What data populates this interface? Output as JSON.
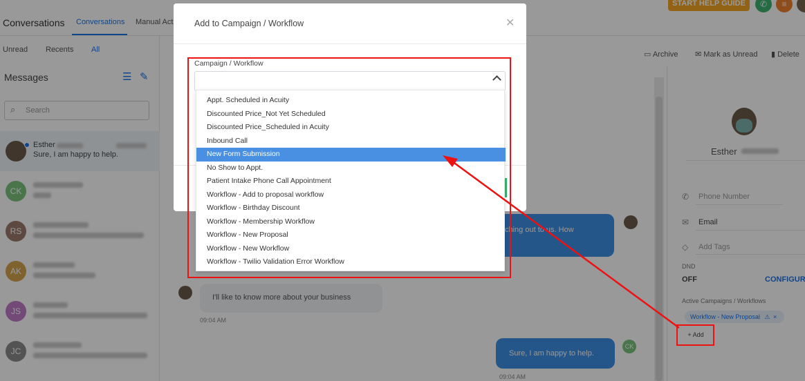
{
  "app": {
    "title": "Conversations",
    "top_tabs": [
      "Conversations",
      "Manual Acti"
    ],
    "help_button": "START HELP GUIDE"
  },
  "left": {
    "filter_tabs": [
      "Unread",
      "Recents",
      "All"
    ],
    "active_filter": "All",
    "messages_title": "Messages",
    "search_placeholder": "Search",
    "conversations": [
      {
        "initials": "",
        "name": "Esther",
        "preview": "Sure, I am happy to help.",
        "selected": true
      },
      {
        "initials": "CK",
        "color": "#7cc47e"
      },
      {
        "initials": "RS",
        "color": "#9c7b6a"
      },
      {
        "initials": "AK",
        "color": "#d4a44c"
      },
      {
        "initials": "JS",
        "color": "#c07ac8"
      },
      {
        "initials": "JC",
        "color": "#8a8a8a"
      }
    ]
  },
  "toolbar": {
    "archive": "Archive",
    "mark_unread": "Mark as Unread",
    "delete": "Delete"
  },
  "chat": {
    "incoming_partial": "ching out to us. How",
    "incoming_message": "I'll like to know more about your business",
    "incoming_time": "09:04 AM",
    "outgoing_message": "Sure, I am happy to help.",
    "outgoing_time": "09:04 AM",
    "outgoing_avatar": "CK"
  },
  "contact": {
    "name": "Esther",
    "phone_placeholder": "Phone Number",
    "email_label": "Email",
    "tags_placeholder": "Add Tags",
    "dnd_label": "DND",
    "dnd_value": "OFF",
    "configure": "CONFIGURE",
    "active_label": "Active Campaigns / Workflows",
    "active_chip": "Workflow - New Proposal",
    "add_label": "+ Add"
  },
  "modal": {
    "title": "Add to Campaign / Workflow",
    "field_label": "Campaign / Workflow",
    "select_value": "",
    "options": [
      "Appt. Scheduled in Acuity",
      "Discounted Price_Not Yet Scheduled",
      "Discounted Price_Scheduled in Acuity",
      "Inbound Call",
      "New Form Submission",
      "No Show to Appt.",
      "Patient Intake Phone Call Appointment",
      "Workflow - Add to proposal workflow",
      "Workflow - Birthday Discount",
      "Workflow - Membership Workflow",
      "Workflow - New Proposal",
      "Workflow - New Workflow",
      "Workflow - Twilio Validation Error Workflow"
    ],
    "highlighted_option": "New Form Submission"
  },
  "colors": {
    "accent": "#1a73e8",
    "highlight": "#4a90e2",
    "annotation": "#e11111",
    "help_button": "#f5a623"
  }
}
